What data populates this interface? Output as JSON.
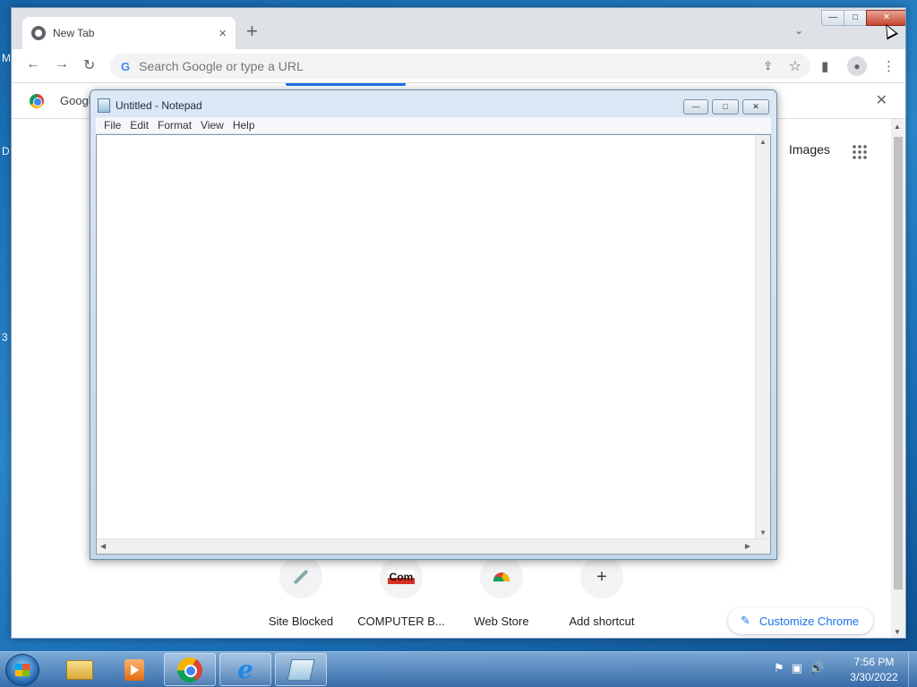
{
  "desktop": {
    "edge_glyphs": [
      "M",
      "D",
      "3"
    ]
  },
  "chrome": {
    "tab": {
      "title": "New Tab",
      "close": "×"
    },
    "new_tab": "+",
    "tab_search": "⌄",
    "window_controls": {
      "minimize": "—",
      "maximize": "□",
      "close": "✕"
    },
    "toolbar": {
      "back": "←",
      "forward": "→",
      "reload": "↻",
      "omnibox_g": "G",
      "omnibox_placeholder": "Search Google or type a URL",
      "share": "⇪",
      "bookmark": "☆",
      "side_panel": "▮",
      "profile": "●",
      "menu": "⋮"
    },
    "infobar": {
      "text": "Googl",
      "dismiss": "✕"
    },
    "ntp": {
      "images_link": "Images",
      "shortcuts": [
        {
          "label": "Site Blocked"
        },
        {
          "label": "COMPUTER B...",
          "icon_text": "Com"
        },
        {
          "label": "Web Store"
        },
        {
          "label": "Add shortcut",
          "icon_text": "+"
        }
      ],
      "customize_label": "Customize Chrome",
      "customize_icon": "✎"
    }
  },
  "notepad": {
    "title": "Untitled - Notepad",
    "controls": {
      "minimize": "—",
      "maximize": "□",
      "close": "✕"
    },
    "menu": [
      "File",
      "Edit",
      "Format",
      "View",
      "Help"
    ],
    "scroll_arrows": {
      "up": "▲",
      "down": "▼",
      "left": "◀",
      "right": "▶"
    }
  },
  "taskbar": {
    "pinned": [
      "file-explorer",
      "media-player",
      "chrome",
      "internet-explorer",
      "notepad"
    ],
    "ie_glyph": "e",
    "tray_icons": [
      "⚑",
      "▣",
      "🔊"
    ],
    "time": "7:56 PM",
    "date": "3/30/2022"
  }
}
